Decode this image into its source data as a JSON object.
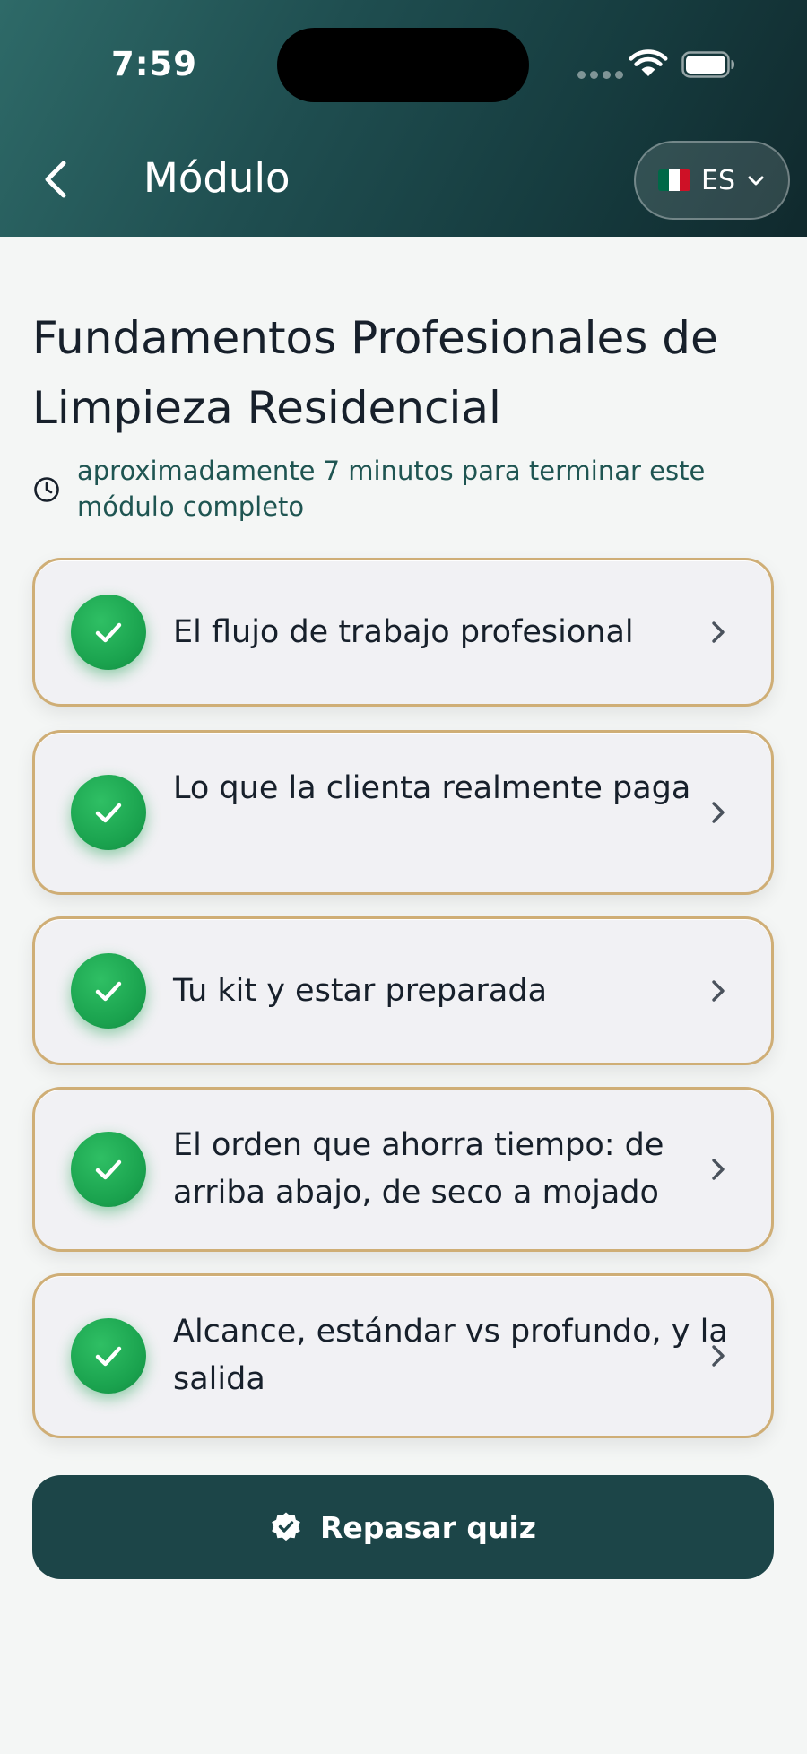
{
  "status_bar": {
    "time": "7:59"
  },
  "header": {
    "title": "Módulo",
    "language": {
      "code": "ES",
      "flag_colors": [
        "#006847",
        "#ffffff",
        "#ce1126"
      ]
    }
  },
  "module": {
    "title": "Fundamentos Profesionales de Limpieza Residencial",
    "duration_text": "aproximadamente 7 minutos para terminar este módulo completo"
  },
  "lessons": [
    {
      "label": "El flujo de trabajo profesional",
      "completed": true
    },
    {
      "label": "Lo que la clienta realmente paga",
      "completed": true
    },
    {
      "label": "Tu kit y estar preparada",
      "completed": true
    },
    {
      "label": "El orden que ahorra tiempo: de arriba abajo, de seco a mojado",
      "completed": true
    },
    {
      "label": "Alcance, estándar vs profundo, y la salida",
      "completed": true
    }
  ],
  "quiz_button": {
    "label": "Repasar quiz"
  },
  "colors": {
    "header_gradient_start": "#2e6a68",
    "header_gradient_end": "#10292d",
    "card_border": "#cfae76",
    "check_green": "#1aa24e",
    "primary_button": "#1c4548",
    "duration_text": "#1f5552"
  },
  "icons": {
    "back": "chevron-left-icon",
    "language_dropdown": "chevron-down-icon",
    "duration": "clock-icon",
    "lesson_status": "check-icon",
    "lesson_open": "chevron-right-icon",
    "quiz": "badge-check-icon"
  }
}
